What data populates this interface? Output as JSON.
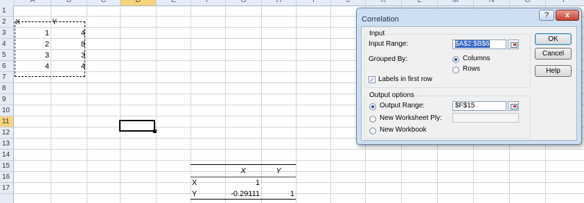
{
  "columns": [
    "A",
    "B",
    "C",
    "D",
    "E",
    "F",
    "G",
    "H",
    "I",
    "J",
    "K",
    "L",
    "M",
    "N",
    "O",
    "P"
  ],
  "rows": [
    "1",
    "2",
    "3",
    "4",
    "5",
    "6",
    "7",
    "8",
    "9",
    "10",
    "11",
    "12",
    "13",
    "14",
    "15",
    "16",
    "17"
  ],
  "selected_column": "D",
  "selected_row": "11",
  "input_data": {
    "headers": [
      "X",
      "Y"
    ],
    "x_values": [
      "1",
      "2",
      "3",
      "4"
    ],
    "y_values": [
      "4",
      "8",
      "3",
      "4"
    ]
  },
  "output_table": {
    "col_headers": [
      "X",
      "Y"
    ],
    "row_labels": [
      "X",
      "Y"
    ],
    "r16": [
      "1",
      ""
    ],
    "r17": [
      "-0.29111",
      "1"
    ]
  },
  "dialog": {
    "title": "Correlation",
    "help_icon": "?",
    "close_icon": "x",
    "input_group": "Input",
    "input_range_label": "Input Range:",
    "input_range_value": "$A$2:$B$6",
    "grouped_by_label": "Grouped By:",
    "columns_option": "Columns",
    "rows_option": "Rows",
    "labels_checkbox": "Labels in first row",
    "output_group": "Output options",
    "output_range_label": "Output Range:",
    "output_range_value": "$F$15",
    "new_ply_label": "New Worksheet Ply:",
    "new_workbook_label": "New Workbook",
    "ok_label": "OK",
    "cancel_label": "Cancel",
    "help_label": "Help"
  }
}
